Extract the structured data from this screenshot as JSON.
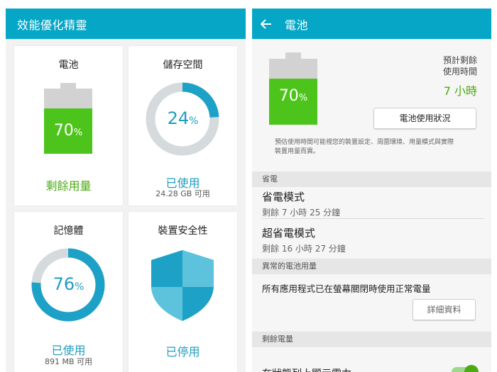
{
  "left": {
    "appbar_title": "效能優化精靈",
    "battery_card": {
      "title": "電池",
      "percent": "70",
      "unit": "%",
      "level": 0.7,
      "status": "剩餘用量"
    },
    "storage_card": {
      "title": "儲存空間",
      "percent": "24",
      "unit": "%",
      "level": 0.24,
      "status": "已使用",
      "sub": "24.28 GB 可用"
    },
    "memory_card": {
      "title": "記憶體",
      "percent": "76",
      "unit": "%",
      "level": 0.76,
      "status": "已使用",
      "sub": "891 MB 可用"
    },
    "security_card": {
      "title": "裝置安全性",
      "status": "已停用"
    }
  },
  "right": {
    "appbar_title": "電池",
    "battery": {
      "percent": "70",
      "unit": "%",
      "level": 0.7
    },
    "estimate_label_line1": "預計剩餘",
    "estimate_label_line2": "使用時間",
    "estimate_value": "7 小時",
    "usage_button": "電池使用狀況",
    "note_line1": "預估使用時間可能視您的裝置設定、周圍環境、用量模式與實際",
    "note_line2": "裝置用量而異。",
    "power_saving_header": "省電",
    "power_saving_mode": {
      "title": "省電模式",
      "sub": "剩餘 7 小時 25 分鐘"
    },
    "ultra_power_saving_mode": {
      "title": "超省電模式",
      "sub": "剩餘 16 小時 27 分鐘"
    },
    "abnormal_header": "異常的電池用量",
    "abnormal_text": "所有應用程式已在螢幕關閉時使用正常電量",
    "details_button": "詳細資料",
    "remaining_header": "剩餘電量",
    "partial_row_text": "在狀態列上顯示電力"
  },
  "colors": {
    "accent": "#06a6c6",
    "battery_green": "#4cc41b",
    "ring_blue": "#1da1c7",
    "ring_gray": "#d5dadd",
    "status_green": "#4caa14",
    "status_blue": "#1f9ec0"
  }
}
